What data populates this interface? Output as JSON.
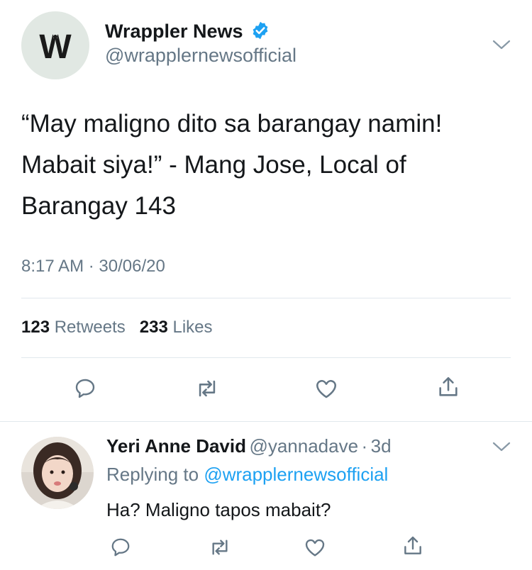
{
  "tweet": {
    "author_name": "Wrappler News",
    "author_handle": "@wrapplernewsofficial",
    "text": "“May maligno dito sa barangay namin! Mabait siya!” - Mang Jose, Local of Barangay 143",
    "time": "8:17 AM",
    "date": "30/06/20",
    "meta_separator": "·",
    "retweets_count": "123",
    "retweets_label": "Retweets",
    "likes_count": "233",
    "likes_label": "Likes",
    "logo_text": "W"
  },
  "reply": {
    "author_name": "Yeri Anne David",
    "author_handle": "@yannadave",
    "age_separator": "·",
    "age": "3d",
    "replying_to_label": "Replying to",
    "replying_to_handle": "@wrapplernewsofficial",
    "text": "Ha? Maligno tapos mabait?"
  },
  "icons": {
    "verified": "verified-badge-icon",
    "more": "chevron-down-icon",
    "reply": "reply-icon",
    "retweet": "retweet-icon",
    "like": "heart-icon",
    "share": "share-icon"
  },
  "colors": {
    "brand_blue": "#1da1f2",
    "muted_text": "#657786",
    "divider": "#e1e8ed"
  }
}
